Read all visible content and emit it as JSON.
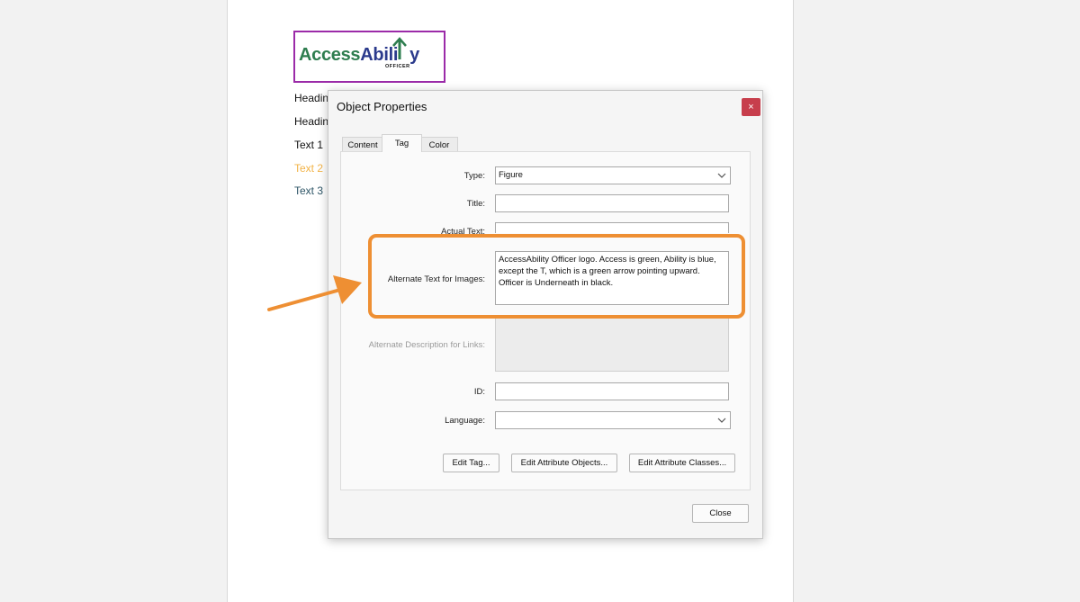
{
  "document": {
    "logo": {
      "access": "AccessAbili",
      "ability": "y",
      "officer": "OFFICER"
    },
    "items": [
      {
        "label": "Headin",
        "color": "#111111"
      },
      {
        "label": "Headin",
        "color": "#111111"
      },
      {
        "label": "Text 1",
        "color": "#111111"
      },
      {
        "label": "Text 2",
        "color": "#f2b347"
      },
      {
        "label": "Text 3",
        "color": "#2d5566"
      }
    ]
  },
  "dialog": {
    "title": "Object Properties",
    "close_icon": "×",
    "tabs": [
      {
        "label": "Content",
        "active": false
      },
      {
        "label": "Tag",
        "active": true
      },
      {
        "label": "Color",
        "active": false
      }
    ],
    "fields": {
      "type": {
        "label": "Type:",
        "value": "Figure"
      },
      "title": {
        "label": "Title:",
        "value": ""
      },
      "actual_text": {
        "label": "Actual Text:",
        "value": ""
      },
      "alt_text": {
        "label": "Alternate Text for Images:",
        "value": "AccessAbility Officer logo. Access is green, Ability is blue, except the T, which is a green arrow pointing upward. Officer is Underneath in black."
      },
      "alt_desc_links": {
        "label": "Alternate Description for Links:",
        "value": ""
      },
      "id": {
        "label": "ID:",
        "value": ""
      },
      "language": {
        "label": "Language:",
        "value": ""
      }
    },
    "buttons": {
      "edit_tag": "Edit Tag...",
      "edit_attr_objects": "Edit Attribute Objects...",
      "edit_attr_classes": "Edit Attribute Classes...",
      "close": "Close"
    }
  },
  "colors": {
    "highlight": "#ee8f33",
    "logo_border": "#9b2ba8",
    "close_button": "#c73e4c"
  }
}
